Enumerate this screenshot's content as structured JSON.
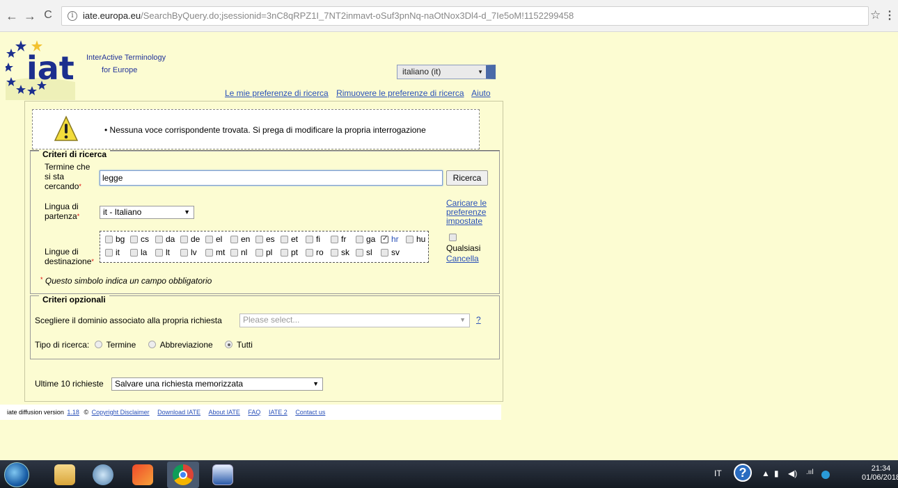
{
  "browser": {
    "url_domain": "iate.europa.eu",
    "url_path": "/SearchByQuery.do;jsessionid=3nC8qRPZ1I_7NT2inmavt-oSuf3pnNq-naOtNox3Dl4-d_7Ie5oM!1152299458"
  },
  "logo": {
    "line1": "InterActive Terminology",
    "line2": "for Europe"
  },
  "interface_language": "italiano (it)",
  "top_links": {
    "preferences": "Le mie preferenze di ricerca",
    "remove_preferences": "Rimuovere le preferenze di ricerca",
    "help": "Aiuto"
  },
  "message": "• Nessuna voce corrispondente trovata. Si prega di modificare la propria interrogazione",
  "criteria": {
    "legend": "Criteri di ricerca",
    "term_label": "Termine che si sta cercando",
    "term_value": "legge",
    "search_button": "Ricerca",
    "source_label": "Lingua di partenza",
    "source_value": "it - Italiano",
    "load_prefs": "Caricare le preferenze impostate",
    "target_label": "Lingue di destinazione",
    "any_label": "Qualsiasi",
    "clear_link": "Cancella",
    "required_note": "Questo simbolo indica un campo obbligatorio",
    "languages_row1": [
      {
        "code": "bg",
        "checked": false
      },
      {
        "code": "cs",
        "checked": false
      },
      {
        "code": "da",
        "checked": false
      },
      {
        "code": "de",
        "checked": false
      },
      {
        "code": "el",
        "checked": false
      },
      {
        "code": "en",
        "checked": false
      },
      {
        "code": "es",
        "checked": false
      },
      {
        "code": "et",
        "checked": false
      },
      {
        "code": "fi",
        "checked": false
      },
      {
        "code": "fr",
        "checked": false
      },
      {
        "code": "ga",
        "checked": false
      },
      {
        "code": "hr",
        "checked": true
      },
      {
        "code": "hu",
        "checked": false
      }
    ],
    "languages_row2": [
      {
        "code": "it",
        "checked": false
      },
      {
        "code": "la",
        "checked": false
      },
      {
        "code": "lt",
        "checked": false
      },
      {
        "code": "lv",
        "checked": false
      },
      {
        "code": "mt",
        "checked": false
      },
      {
        "code": "nl",
        "checked": false
      },
      {
        "code": "pl",
        "checked": false
      },
      {
        "code": "pt",
        "checked": false
      },
      {
        "code": "ro",
        "checked": false
      },
      {
        "code": "sk",
        "checked": false
      },
      {
        "code": "sl",
        "checked": false
      },
      {
        "code": "sv",
        "checked": false
      }
    ]
  },
  "optional": {
    "legend": "Criteri opzionali",
    "domain_label": "Scegliere il dominio associato alla propria richiesta",
    "domain_placeholder": "Please select...",
    "domain_help": "?",
    "type_label": "Tipo di ricerca:",
    "type_options": [
      "Termine",
      "Abbreviazione",
      "Tutti"
    ],
    "type_selected": "Tutti"
  },
  "recent": {
    "label": "Ultime 10 richieste",
    "value": "Salvare una richiesta memorizzata"
  },
  "footer": {
    "version_text": "iate diffusion version",
    "version_link": "1.18",
    "copyright": "©",
    "links": [
      "Copyright Disclaimer",
      "Download IATE",
      "About IATE",
      "FAQ",
      "IATE 2",
      "Contact us"
    ]
  },
  "taskbar": {
    "lang": "IT",
    "time": "21:34",
    "date": "01/06/2018"
  }
}
